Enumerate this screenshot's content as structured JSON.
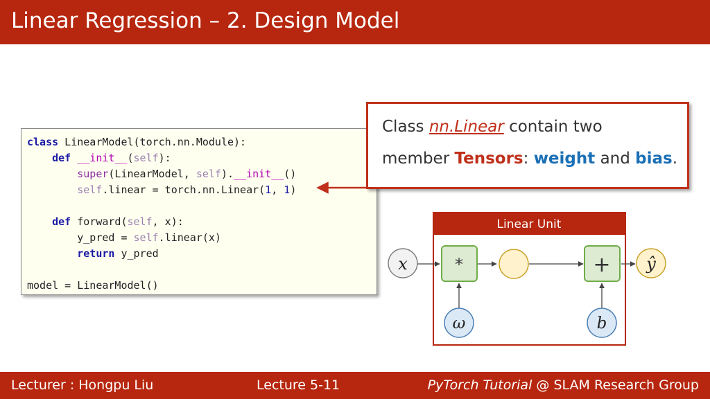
{
  "title": "Linear Regression – 2. Design Model",
  "code": {
    "lines": [
      [
        {
          "t": "class",
          "c": "kw"
        },
        {
          "t": " LinearModel(torch.nn.Module):"
        }
      ],
      [
        {
          "t": "    "
        },
        {
          "t": "def",
          "c": "kw"
        },
        {
          "t": " "
        },
        {
          "t": "__init__",
          "c": "dn"
        },
        {
          "t": "("
        },
        {
          "t": "self",
          "c": "sf"
        },
        {
          "t": "):"
        }
      ],
      [
        {
          "t": "        "
        },
        {
          "t": "super",
          "c": "bi"
        },
        {
          "t": "(LinearModel, "
        },
        {
          "t": "self",
          "c": "sf"
        },
        {
          "t": ")."
        },
        {
          "t": "__init__",
          "c": "dn"
        },
        {
          "t": "()"
        }
      ],
      [
        {
          "t": "        "
        },
        {
          "t": "self",
          "c": "sf"
        },
        {
          "t": ".linear = torch.nn.Linear("
        },
        {
          "t": "1",
          "c": "nm"
        },
        {
          "t": ", "
        },
        {
          "t": "1",
          "c": "nm"
        },
        {
          "t": ")"
        }
      ],
      [
        {
          "t": ""
        }
      ],
      [
        {
          "t": "    "
        },
        {
          "t": "def",
          "c": "kw"
        },
        {
          "t": " forward("
        },
        {
          "t": "self",
          "c": "sf"
        },
        {
          "t": ", x):"
        }
      ],
      [
        {
          "t": "        y_pred = "
        },
        {
          "t": "self",
          "c": "sf"
        },
        {
          "t": ".linear(x)"
        }
      ],
      [
        {
          "t": "        "
        },
        {
          "t": "return",
          "c": "kw"
        },
        {
          "t": " y_pred"
        }
      ],
      [
        {
          "t": ""
        }
      ],
      [
        {
          "t": "model = LinearModel()"
        }
      ]
    ]
  },
  "callout": {
    "line1_prefix": "Class ",
    "line1_link": "nn.Linear",
    "line1_suffix": " contain two",
    "line2_prefix": "member ",
    "line2_tensors": "Tensors",
    "line2_colon": ": ",
    "line2_weight": "weight",
    "line2_and": " and ",
    "line2_bias": "bias",
    "line2_period": "."
  },
  "diagram": {
    "box_title": "Linear Unit",
    "input_x": "x",
    "multiply": "*",
    "add": "+",
    "output_y": "ŷ",
    "weight": "ω",
    "bias": "b",
    "colors": {
      "accent": "#b7270f",
      "green_fill": "#dcebd2",
      "green_stroke": "#70ad47",
      "yellow_fill": "#fff2cc",
      "yellow_stroke": "#c9a227",
      "blue_fill": "#dbe8f5",
      "blue_stroke": "#4a7fb5"
    }
  },
  "footer": {
    "lecturer": "Lecturer : Hongpu Liu",
    "lecture": "Lecture 5-11",
    "course_italic": "PyTorch Tutorial",
    "course_rest": " @ SLAM Research Group"
  }
}
